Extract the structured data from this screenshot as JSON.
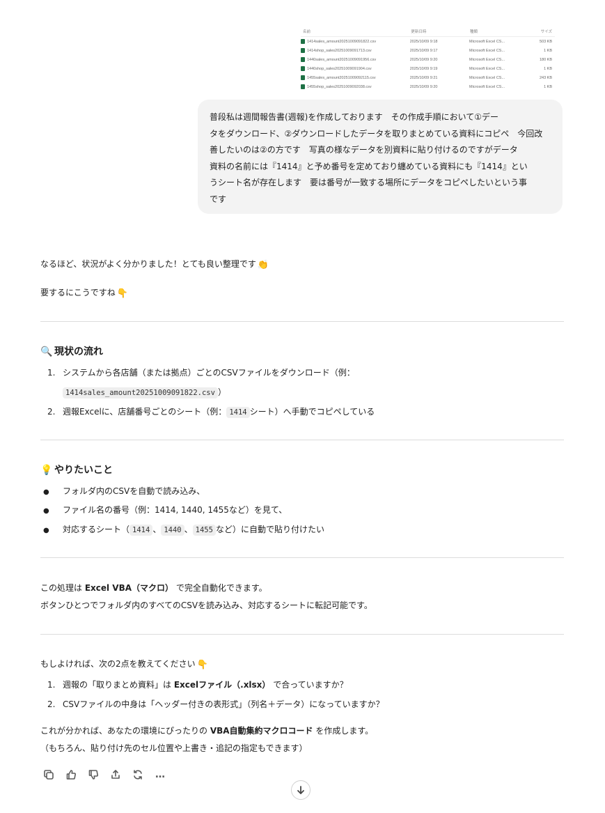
{
  "file_list": {
    "headers": [
      "名前",
      "更新日時",
      "種類",
      "サイズ"
    ],
    "rows": [
      {
        "name": "1414sales_amount20251009091822.csv",
        "date": "2025/10/09 9:18",
        "type": "Microsoft Excel CS...",
        "size": "503 KB"
      },
      {
        "name": "1414shop_sales20251009091713.csv",
        "date": "2025/10/09 9:17",
        "type": "Microsoft Excel CS...",
        "size": "1 KB"
      },
      {
        "name": "1440sales_amount20251009091956.csv",
        "date": "2025/10/09 9:20",
        "type": "Microsoft Excel CS...",
        "size": "180 KB"
      },
      {
        "name": "1440shop_sales20251009091904.csv",
        "date": "2025/10/09 9:19",
        "type": "Microsoft Excel CS...",
        "size": "1 KB"
      },
      {
        "name": "1455sales_amount20251009092115.csv",
        "date": "2025/10/09 9:21",
        "type": "Microsoft Excel CS...",
        "size": "243 KB"
      },
      {
        "name": "1455shop_sales20251009092038.csv",
        "date": "2025/10/09 9:20",
        "type": "Microsoft Excel CS...",
        "size": "1 KB"
      }
    ]
  },
  "user_message": {
    "lines": [
      "普段私は週間報告書(週報)を作成しております　その作成手順において①デー",
      "タをダウンロード、②ダウンロードしたデータを取りまとめている資料にコピペ　今回改",
      "善したいのは②の方です　写真の様なデータを別資料に貼り付けるのですがデータ",
      "資料の名前には『1414』と予め番号を定めており纏めている資料にも『1414』とい",
      "うシート名が存在します　要は番号が一致する場所にデータをコピペしたいという事",
      "です"
    ]
  },
  "assistant": {
    "intro1": "なるほど、状況がよく分かりました！とても良い整理です",
    "intro1_emoji": "👏",
    "intro2": "要するにこうですね",
    "intro2_emoji": "👇",
    "sec1_icon": "🔍",
    "sec1_title": "現状の流れ",
    "sec1_items": [
      {
        "num": "1.",
        "text": "システムから各店舗（または拠点）ごとのCSVファイルをダウンロード（例：",
        "code": "1414sales_amount20251009091822.csv",
        "after": "）"
      },
      {
        "num": "2.",
        "pre": "週報Excelに、店舗番号ごとのシート（例：",
        "code": "1414",
        "post": "シート）へ手動でコピペしている"
      }
    ],
    "sec2_icon": "💡",
    "sec2_title": "やりたいこと",
    "sec2_items": [
      "フォルダ内のCSVを自動で読み込み、",
      "ファイル名の番号（例：1414, 1440, 1455など）を見て、"
    ],
    "sec2_item3": {
      "pre": "対応するシート（",
      "codes": [
        "1414",
        "1440",
        "1455"
      ],
      "sep": "、",
      "post": "など）に自動で貼り付けたい"
    },
    "vba_pre": "この処理は ",
    "vba_bold": "Excel VBA（マクロ）",
    "vba_post": " で完全自動化できます。",
    "vba_line2": "ボタンひとつでフォルダ内のすべてのCSVを読み込み、対応するシートに転記可能です。",
    "ask": "もしよければ、次の2点を教えてください",
    "ask_emoji": "👇",
    "q1_num": "1.",
    "q1_pre": "週報の「取りまとめ資料」は ",
    "q1_bold": "Excelファイル（.xlsx）",
    "q1_post": " で合っていますか？",
    "q2_num": "2.",
    "q2": "CSVファイルの中身は「ヘッダー付きの表形式」（列名＋データ）になっていますか？",
    "closing_pre": "これが分かれば、あなたの環境にぴったりの ",
    "closing_bold": "VBA自動集約マクロコード",
    "closing_post": " を作成します。",
    "closing2": "（もちろん、貼り付け先のセル位置や上書き・追記の指定もできます）"
  },
  "actions": [
    "copy-icon",
    "thumbs-up-icon",
    "thumbs-down-icon",
    "share-icon",
    "regenerate-icon",
    "more-icon"
  ],
  "more_label": "…"
}
